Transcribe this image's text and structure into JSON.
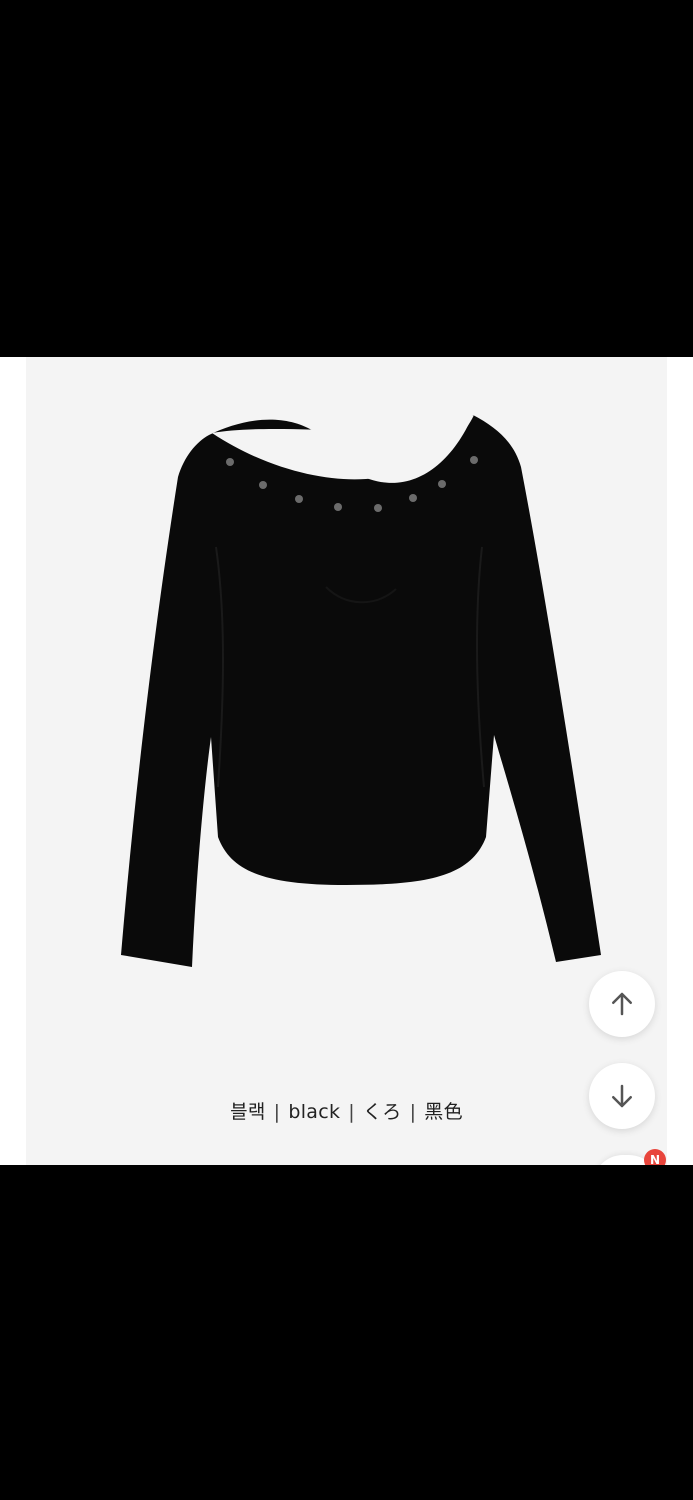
{
  "product": {
    "color_label": {
      "korean": "블랙",
      "english": "black",
      "japanese": "くろ",
      "chinese": "黑色",
      "separator": "|"
    }
  },
  "controls": {
    "scroll_up_icon": "arrow-up-icon",
    "scroll_down_icon": "arrow-down-icon",
    "notification_badge": "N",
    "badge_color": "#e8453c"
  },
  "colors": {
    "background": "#000000",
    "photo_background": "#f4f4f4",
    "garment": "#0a0a0a"
  }
}
